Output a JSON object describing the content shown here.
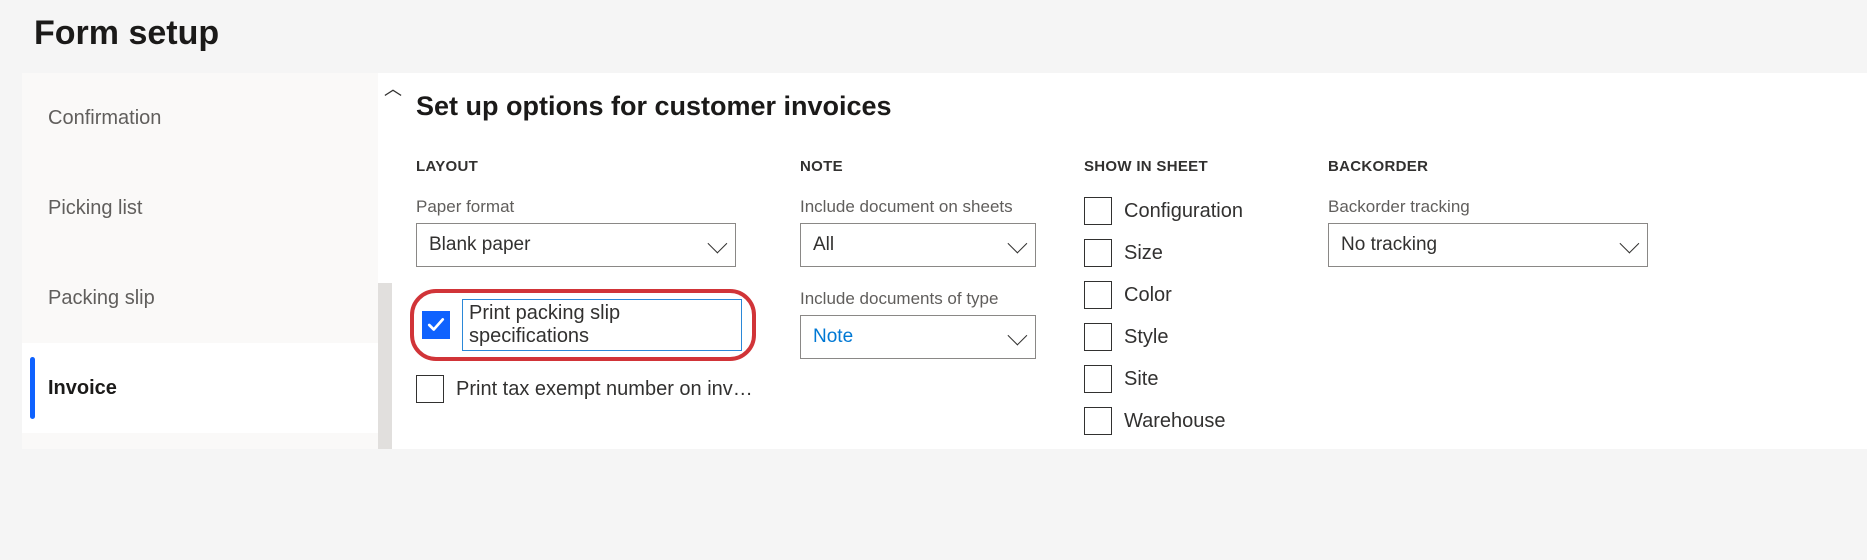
{
  "page_title": "Form setup",
  "sidebar": {
    "items": [
      {
        "label": "Confirmation",
        "active": false
      },
      {
        "label": "Picking list",
        "active": false
      },
      {
        "label": "Packing slip",
        "active": false
      },
      {
        "label": "Invoice",
        "active": true
      }
    ]
  },
  "main": {
    "heading": "Set up options for customer invoices",
    "layout": {
      "section": "LAYOUT",
      "paper_format_label": "Paper format",
      "paper_format_value": "Blank paper",
      "print_packing_slip_label": "Print packing slip specifications",
      "print_packing_slip_checked": true,
      "print_tax_exempt_label": "Print tax exempt number on inv…",
      "print_tax_exempt_checked": false
    },
    "note": {
      "section": "NOTE",
      "include_on_sheets_label": "Include document on sheets",
      "include_on_sheets_value": "All",
      "include_type_label": "Include documents of type",
      "include_type_value": "Note"
    },
    "show": {
      "section": "SHOW IN SHEET",
      "items": [
        {
          "label": "Configuration",
          "checked": false
        },
        {
          "label": "Size",
          "checked": false
        },
        {
          "label": "Color",
          "checked": false
        },
        {
          "label": "Style",
          "checked": false
        },
        {
          "label": "Site",
          "checked": false
        },
        {
          "label": "Warehouse",
          "checked": false
        }
      ]
    },
    "backorder": {
      "section": "BACKORDER",
      "tracking_label": "Backorder tracking",
      "tracking_value": "No tracking"
    }
  }
}
